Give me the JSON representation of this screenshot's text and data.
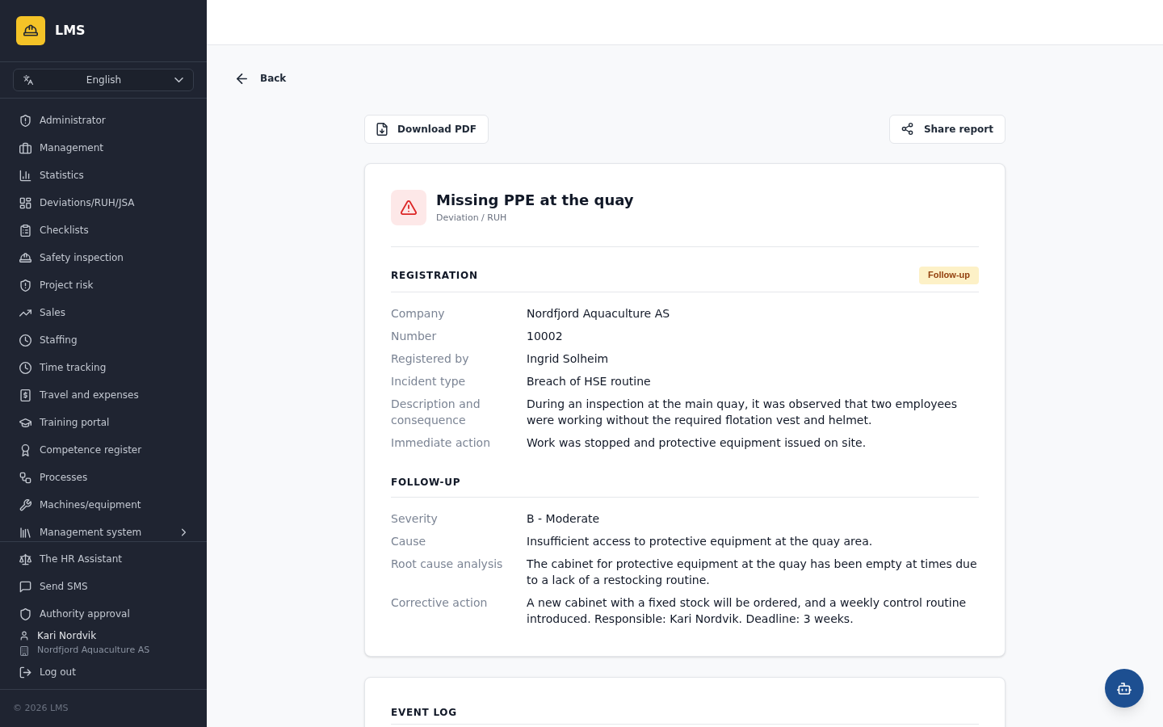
{
  "brand": {
    "name": "LMS"
  },
  "language_select": {
    "value": "English"
  },
  "nav": [
    {
      "label": "Administrator",
      "kind": "link"
    },
    {
      "label": "Management",
      "kind": "link"
    },
    {
      "label": "Statistics",
      "kind": "link"
    },
    {
      "label": "Deviations/RUH/JSA",
      "kind": "link"
    },
    {
      "label": "Checklists",
      "kind": "link"
    },
    {
      "label": "Safety inspection",
      "kind": "link"
    },
    {
      "label": "Project risk",
      "kind": "link"
    },
    {
      "label": "Sales",
      "kind": "link"
    },
    {
      "label": "Staffing",
      "kind": "link"
    },
    {
      "label": "Time tracking",
      "kind": "link"
    },
    {
      "label": "Travel and expenses",
      "kind": "link"
    },
    {
      "label": "Training portal",
      "kind": "link"
    },
    {
      "label": "Competence register",
      "kind": "link"
    },
    {
      "label": "Processes",
      "kind": "link"
    },
    {
      "label": "Machines/equipment",
      "kind": "link"
    },
    {
      "label": "Management system",
      "kind": "group"
    }
  ],
  "nav_bottom": [
    {
      "label": "The HR Assistant"
    },
    {
      "label": "Send SMS"
    },
    {
      "label": "Authority approval"
    }
  ],
  "user": {
    "name": "Kari Nordvik",
    "company": "Nordfjord Aquaculture AS"
  },
  "logout": {
    "label": "Log out"
  },
  "footer": {
    "text": "© 2026 LMS"
  },
  "back": {
    "label": "Back"
  },
  "actions": {
    "download": "Download PDF",
    "share": "Share report"
  },
  "report": {
    "title": "Missing PPE at the quay",
    "category": "Deviation / RUH",
    "sections": [
      {
        "heading": "REGISTRATION",
        "badge": "Follow-up",
        "fields": [
          {
            "label": "Company",
            "value": "Nordfjord Aquaculture AS"
          },
          {
            "label": "Number",
            "value": "10002"
          },
          {
            "label": "Registered by",
            "value": "Ingrid Solheim"
          },
          {
            "label": "Incident type",
            "value": "Breach of HSE routine"
          },
          {
            "label": "Description and consequence",
            "value": "During an inspection at the main quay, it was observed that two employees were working without the required flotation vest and helmet."
          },
          {
            "label": "Immediate action",
            "value": "Work was stopped and protective equipment issued on site."
          }
        ]
      },
      {
        "heading": "FOLLOW-UP",
        "fields": [
          {
            "label": "Severity",
            "value": "B - Moderate"
          },
          {
            "label": "Cause",
            "value": "Insufficient access to protective equipment at the quay area."
          },
          {
            "label": "Root cause analysis",
            "value": "The cabinet for protective equipment at the quay has been empty at times due to a lack of a restocking routine."
          },
          {
            "label": "Corrective action",
            "value": "A new cabinet with a fixed stock will be ordered, and a weekly control routine introduced. Responsible: Kari Nordvik. Deadline: 3 weeks."
          }
        ]
      }
    ]
  },
  "event_log": {
    "heading": "EVENT LOG"
  }
}
